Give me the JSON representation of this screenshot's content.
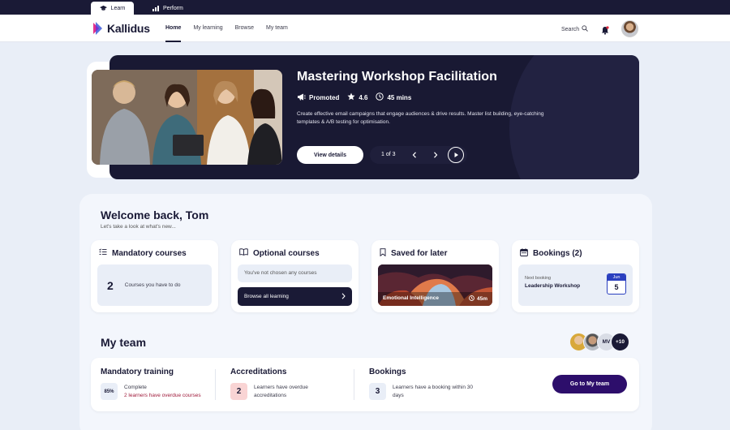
{
  "appbar": {
    "tabs": [
      {
        "label": "Learn",
        "icon": "graduation-cap-icon"
      },
      {
        "label": "Perform",
        "icon": "bar-chart-icon"
      }
    ]
  },
  "nav": {
    "logo_text": "Kallidus",
    "links": [
      "Home",
      "My learning",
      "Browse",
      "My team"
    ],
    "search_label": "Search"
  },
  "hero": {
    "title": "Mastering Workshop Facilitation",
    "promoted_label": "Promoted",
    "rating": "4.6",
    "duration": "45 mins",
    "description": "Create effective email campaigns that engage audiences & drive results. Master list building, eye-catching templates & A/B testing for optimisation.",
    "view_button": "View details",
    "pager": "1 of 3"
  },
  "welcome": {
    "title": "Welcome back, Tom",
    "subtitle": "Let's take a look at what's new..."
  },
  "cards": {
    "mandatory": {
      "title": "Mandatory courses",
      "count": "2",
      "text": "Courses you have to do"
    },
    "optional": {
      "title": "Optional courses",
      "text": "You've not chosen any courses",
      "button": "Browse all learning"
    },
    "saved": {
      "title": "Saved for later",
      "course": "Emotional Intelligence",
      "duration": "45m"
    },
    "bookings": {
      "title": "Bookings (2)",
      "next_label": "Next booking",
      "next_name": "Leadership Workshop",
      "month": "Jun",
      "day": "5"
    }
  },
  "team": {
    "title": "My team",
    "avatars": [
      "MV",
      "+10"
    ],
    "mandatory": {
      "title": "Mandatory training",
      "badge": "85%",
      "line1": "Complete",
      "line2": "2 learners have overdue courses"
    },
    "accreditations": {
      "title": "Accreditations",
      "badge": "2",
      "text": "Learners have overdue accreditations"
    },
    "bookings": {
      "title": "Bookings",
      "badge": "3",
      "text": "Learners have a booking within 30 days"
    },
    "button": "Go to My team"
  },
  "colors": {
    "navy": "#1a1a36",
    "accent_purple": "#2d0e6b",
    "calendar_blue": "#2a3fbf",
    "alert_red": "#a01c3c"
  }
}
